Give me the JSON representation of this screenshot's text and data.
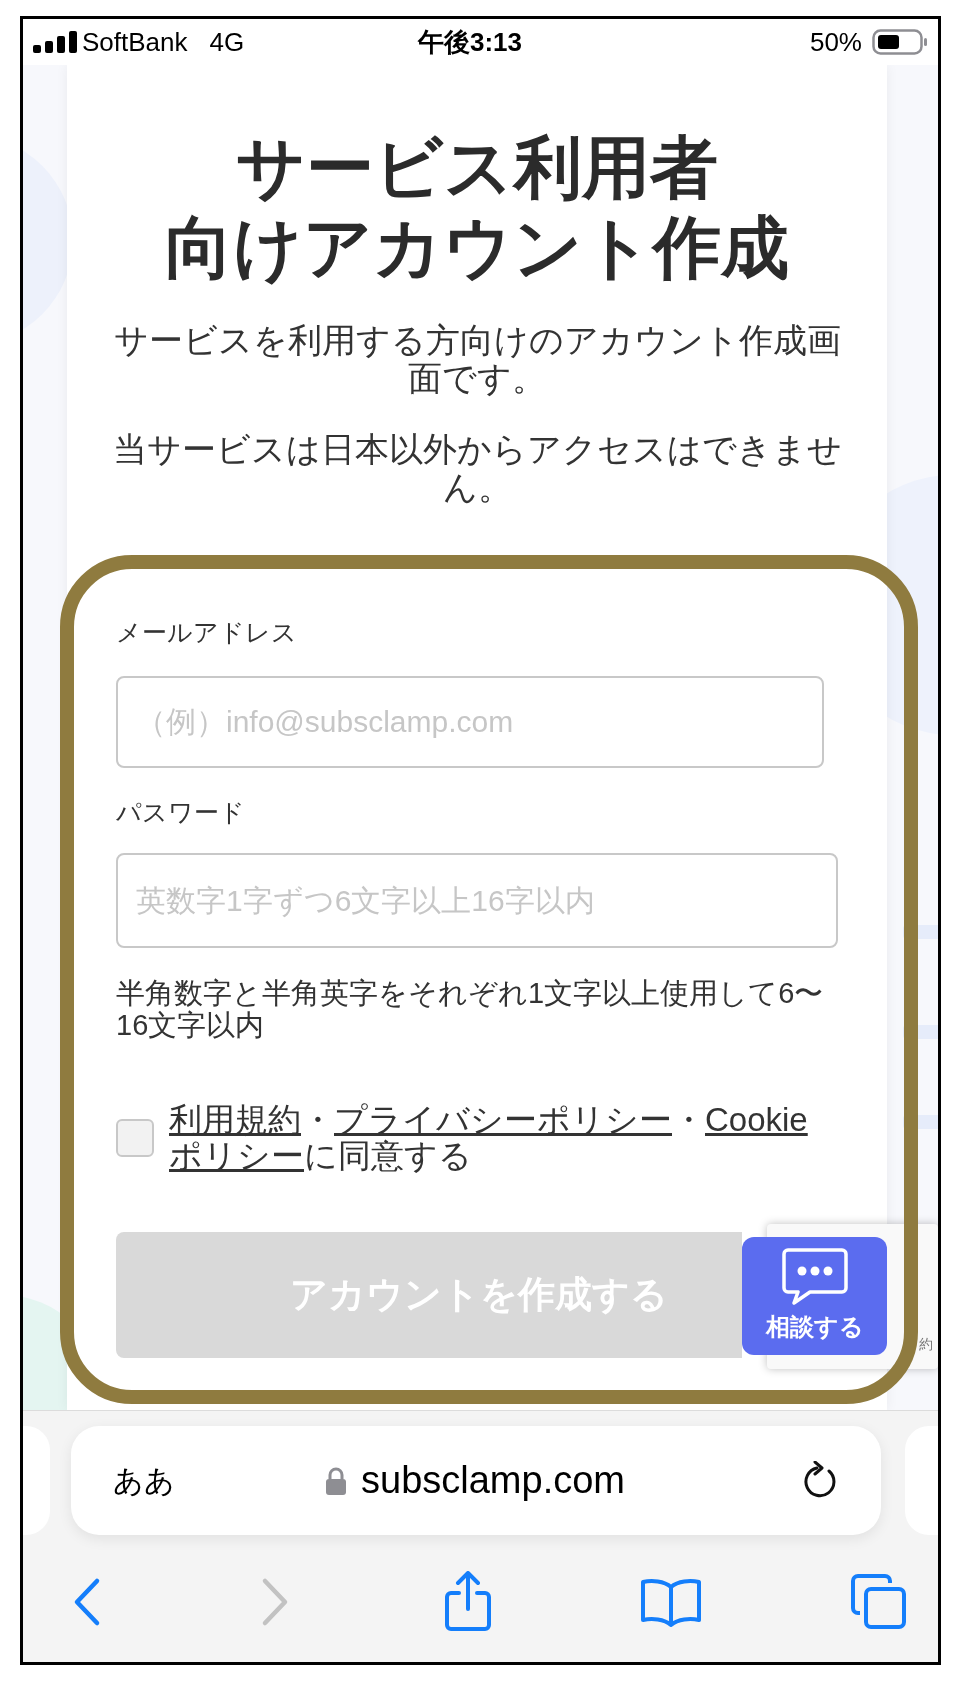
{
  "status_bar": {
    "carrier": "SoftBank",
    "network": "4G",
    "time": "午後3:13",
    "battery": "50%"
  },
  "page": {
    "title_lines": [
      "サービス利用者",
      "向けアカウント作成"
    ],
    "paragraphs": [
      "サービスを利用する方向けのアカウント作成画面です。",
      "当サービスは日本以外からアクセスはできません。"
    ],
    "form": {
      "fields": [
        {
          "label": "メールアドレス",
          "placeholder": "（例）info@subsclamp.com"
        },
        {
          "label": "パスワード",
          "placeholder": "英数字1字ずつ6文字以上16字以内",
          "hint": "半角数字と半角英字をそれぞれ1文字以上使用して6〜16文字以内"
        }
      ],
      "agreement": {
        "checked": false,
        "segments": [
          {
            "text": "利用規約",
            "link": true
          },
          {
            "text": "・",
            "link": false
          },
          {
            "text": "プライバシーポリシー",
            "link": true
          },
          {
            "text": "・",
            "link": false
          },
          {
            "text": "Cookie",
            "link": true
          },
          {
            "text": "ポリシー",
            "link": true
          },
          {
            "text": "に同意する",
            "link": false
          }
        ]
      },
      "submit": {
        "label": "アカウントを作成する",
        "disabled": true
      }
    },
    "chat_button": {
      "label": "相談する"
    },
    "recaptcha_text": "約"
  },
  "browser": {
    "text_size_button": "ああ",
    "url": "subsclamp.com",
    "back_disabled": false,
    "forward_disabled": true
  }
}
